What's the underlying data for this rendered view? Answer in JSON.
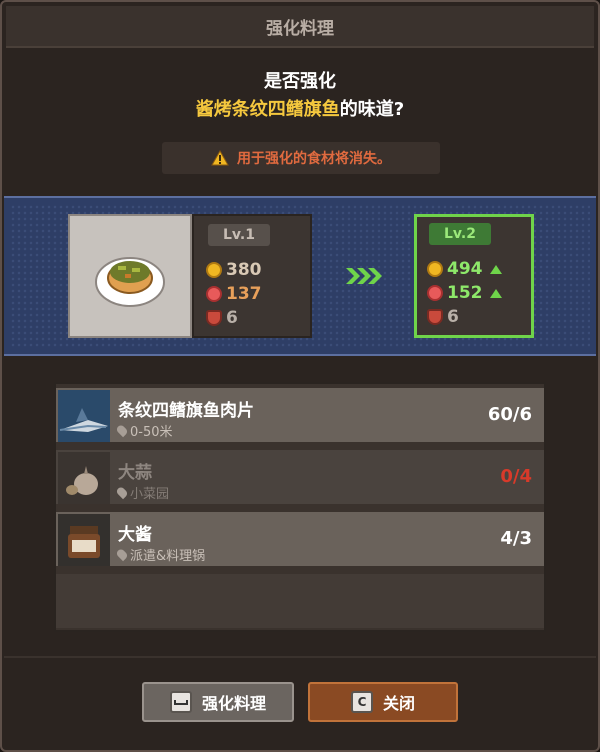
{
  "window": {
    "title": "强化料理"
  },
  "question": {
    "line1": "是否强化",
    "dish_name": "酱烤条纹四鳍旗鱼",
    "suffix": "的味道?"
  },
  "warning": {
    "text": "用于强化的食材将消失。",
    "icon": "warning-icon"
  },
  "upgrade": {
    "current": {
      "level": "Lv.1",
      "price": "380",
      "popularity": "137",
      "servings": "6"
    },
    "next": {
      "level": "Lv.2",
      "price": "494",
      "popularity": "152",
      "servings": "6"
    }
  },
  "materials": [
    {
      "name": "条纹四鳍旗鱼肉片",
      "source": "0-50米",
      "qty": "60/6",
      "icon": "marlin-icon",
      "available": true
    },
    {
      "name": "大蒜",
      "source": "小菜园",
      "qty": "0/4",
      "icon": "garlic-icon",
      "available": false
    },
    {
      "name": "大酱",
      "source": "派遣&料理锅",
      "qty": "4/3",
      "icon": "soybean-paste-jar-icon",
      "available": true
    }
  ],
  "buttons": {
    "confirm": {
      "label": "强化料理",
      "key": "space"
    },
    "close": {
      "label": "关闭",
      "key": "C"
    }
  },
  "colors": {
    "accent_green": "#6fd44a",
    "warning": "#e06a3f",
    "dish_name": "#f5c83e",
    "insufficient": "#d83a2a"
  }
}
